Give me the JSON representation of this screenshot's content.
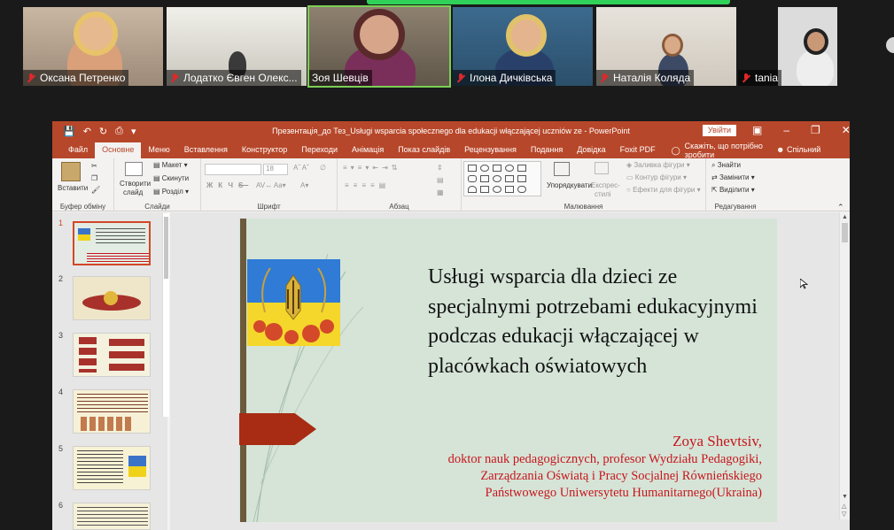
{
  "participants": [
    {
      "name": "Оксана Петренко",
      "muted": true
    },
    {
      "name": "Лодатко Євген Олекс...",
      "muted": true
    },
    {
      "name": "Зоя Шевців",
      "muted": false,
      "active": true
    },
    {
      "name": "Ілона Дичківська",
      "muted": true
    },
    {
      "name": "Наталія Коляда",
      "muted": true
    },
    {
      "name": "tania",
      "muted": true
    }
  ],
  "window": {
    "title": "Презентація_до Тез_Usługi wsparcia społecznego dla edukacji włączającej uczniów ze  -  PowerPoint",
    "login_label": "Увійти"
  },
  "menu": {
    "tabs": [
      "Файл",
      "Основне",
      "Меню",
      "Вставлення",
      "Конструктор",
      "Переходи",
      "Анімація",
      "Показ слайдів",
      "Рецензування",
      "Подання",
      "Довідка",
      "Foxit PDF"
    ],
    "selected": "Основне",
    "tell_me": "Скажіть, що потрібно зробити",
    "share": "Спільний доступ"
  },
  "ribbon": {
    "clipboard": {
      "paste": "Вставити",
      "label": "Буфер обміну"
    },
    "slides": {
      "new_slide": "Створити",
      "new_slide2": "слайд",
      "layout": "Макет",
      "reset": "Скинути",
      "section": "Розділ",
      "label": "Слайди"
    },
    "font": {
      "size": "18",
      "label": "Шрифт"
    },
    "paragraph": {
      "label": "Абзац"
    },
    "drawing": {
      "arrange": "Упорядкувати",
      "quick_styles": "Експрес-",
      "quick_styles2": "стилі",
      "fill": "Заливка фігури",
      "outline": "Контур фігури",
      "effects": "Ефекти для фігури",
      "label": "Малювання"
    },
    "editing": {
      "find": "Знайти",
      "replace": "Замінити",
      "select": "Виділити",
      "label": "Редагування"
    }
  },
  "thumbnails": [
    "1",
    "2",
    "3",
    "4",
    "5",
    "6"
  ],
  "slide": {
    "title": "Usługi wsparcia dla dzieci ze specjalnymi potrzebami edukacyjnymi podczas edukacji włączającej w placówkach oświatowych",
    "author_name": "Zoya Shevtsiv,",
    "author_line1": "doktor nauk pedagogicznych, profesor Wydziału Pedagogiki,",
    "author_line2": "Zarządzania Oświatą i Pracy Socjalnej Równieńskiego",
    "author_line3": "Państwowego Uniwersytetu Humanitarnego(Ukraina)"
  },
  "colors": {
    "ppt_accent": "#b7472a",
    "slide_bg": "#d5e4d7",
    "author_text": "#c8161d",
    "active_speaker": "#7ccf55"
  }
}
